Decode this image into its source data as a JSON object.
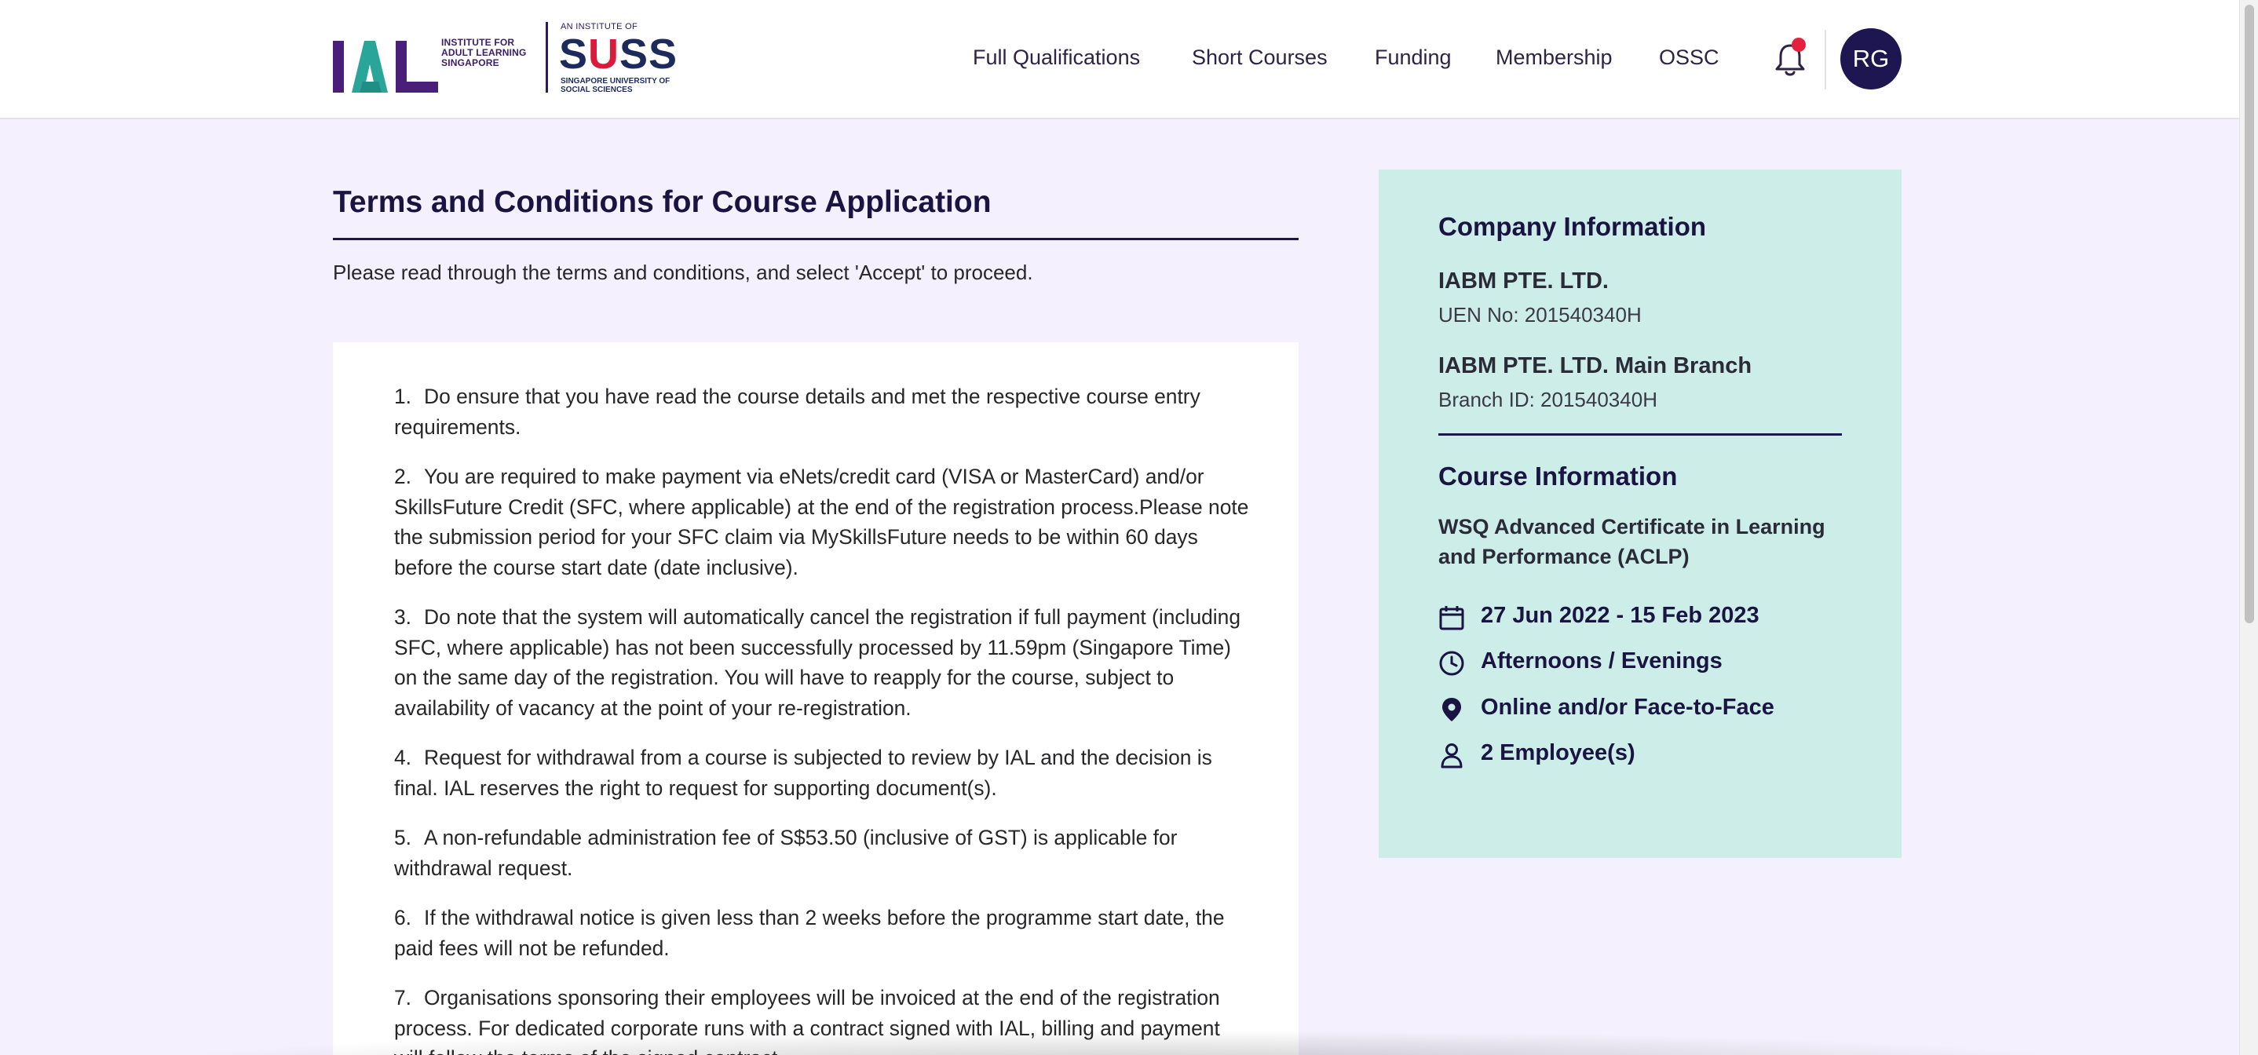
{
  "header": {
    "logo_ial_text": "INSTITUTE FOR ADULT LEARNING SINGAPORE",
    "logo_suss_top": "AN INSTITUTE OF",
    "logo_suss_main": "SUSS",
    "logo_suss_sub": "SINGAPORE UNIVERSITY OF SOCIAL SCIENCES",
    "nav": [
      {
        "label": "Full Qualifications"
      },
      {
        "label": "Short Courses"
      },
      {
        "label": "Funding"
      },
      {
        "label": "Membership"
      },
      {
        "label": "OSSC"
      }
    ],
    "avatar_initials": "RG",
    "has_notification": true
  },
  "main": {
    "title": "Terms and Conditions for Course Application",
    "intro": "Please read through the terms and conditions, and select 'Accept' to proceed.",
    "terms": [
      {
        "num": "1.",
        "text": "Do ensure that you have read the course details and met the respective course entry requirements."
      },
      {
        "num": "2.",
        "text": "You are required to make payment via eNets/credit card (VISA or MasterCard) and/or SkillsFuture Credit (SFC, where applicable) at the end of the registration process.Please note the submission period for your SFC claim via MySkillsFuture needs to be within 60 days before the course start date (date inclusive)."
      },
      {
        "num": "3.",
        "text": "Do note that the system will automatically cancel the registration if full payment (including SFC, where applicable) has not been successfully processed by 11.59pm (Singapore Time) on the same day of the registration. You will have to reapply for the course, subject to availability of vacancy at the point of your re-registration."
      },
      {
        "num": "4.",
        "text": "Request for withdrawal from a course is subjected to review by IAL and the decision is final. IAL reserves the right to request for supporting document(s)."
      },
      {
        "num": "5.",
        "text": "A non-refundable administration fee of S$53.50 (inclusive of GST) is applicable for withdrawal request."
      },
      {
        "num": "6.",
        "text": "If the withdrawal notice is given less than 2 weeks before the programme start date, the paid fees will not be refunded."
      },
      {
        "num": "7.",
        "text": "Organisations sponsoring their employees will be invoiced at the end of the registration process. For dedicated corporate runs with a contract signed with IAL, billing and payment will follow the terms of the signed contract."
      }
    ]
  },
  "panel": {
    "company_heading": "Company Information",
    "company_name": "IABM PTE. LTD.",
    "uen": "UEN No: 201540340H",
    "branch_name": "IABM PTE. LTD. Main Branch",
    "branch_id": "Branch ID: 201540340H",
    "course_heading": "Course Information",
    "course_name": "WSQ Advanced Certificate in Learning and Performance (ACLP)",
    "dates": "27 Jun 2022 - 15 Feb 2023",
    "time": "Afternoons / Evenings",
    "mode": "Online and/or Face-to-Face",
    "employees": "2 Employee(s)",
    "icons": {
      "dates": "calendar-icon",
      "time": "clock-icon",
      "mode": "location-pin-icon",
      "employees": "person-icon"
    }
  },
  "colors": {
    "page_bg": "#f4f0fd",
    "panel_bg": "#cdede8",
    "navy": "#1e1650",
    "notification": "#e5223d",
    "suss_red": "#d81b3a"
  }
}
